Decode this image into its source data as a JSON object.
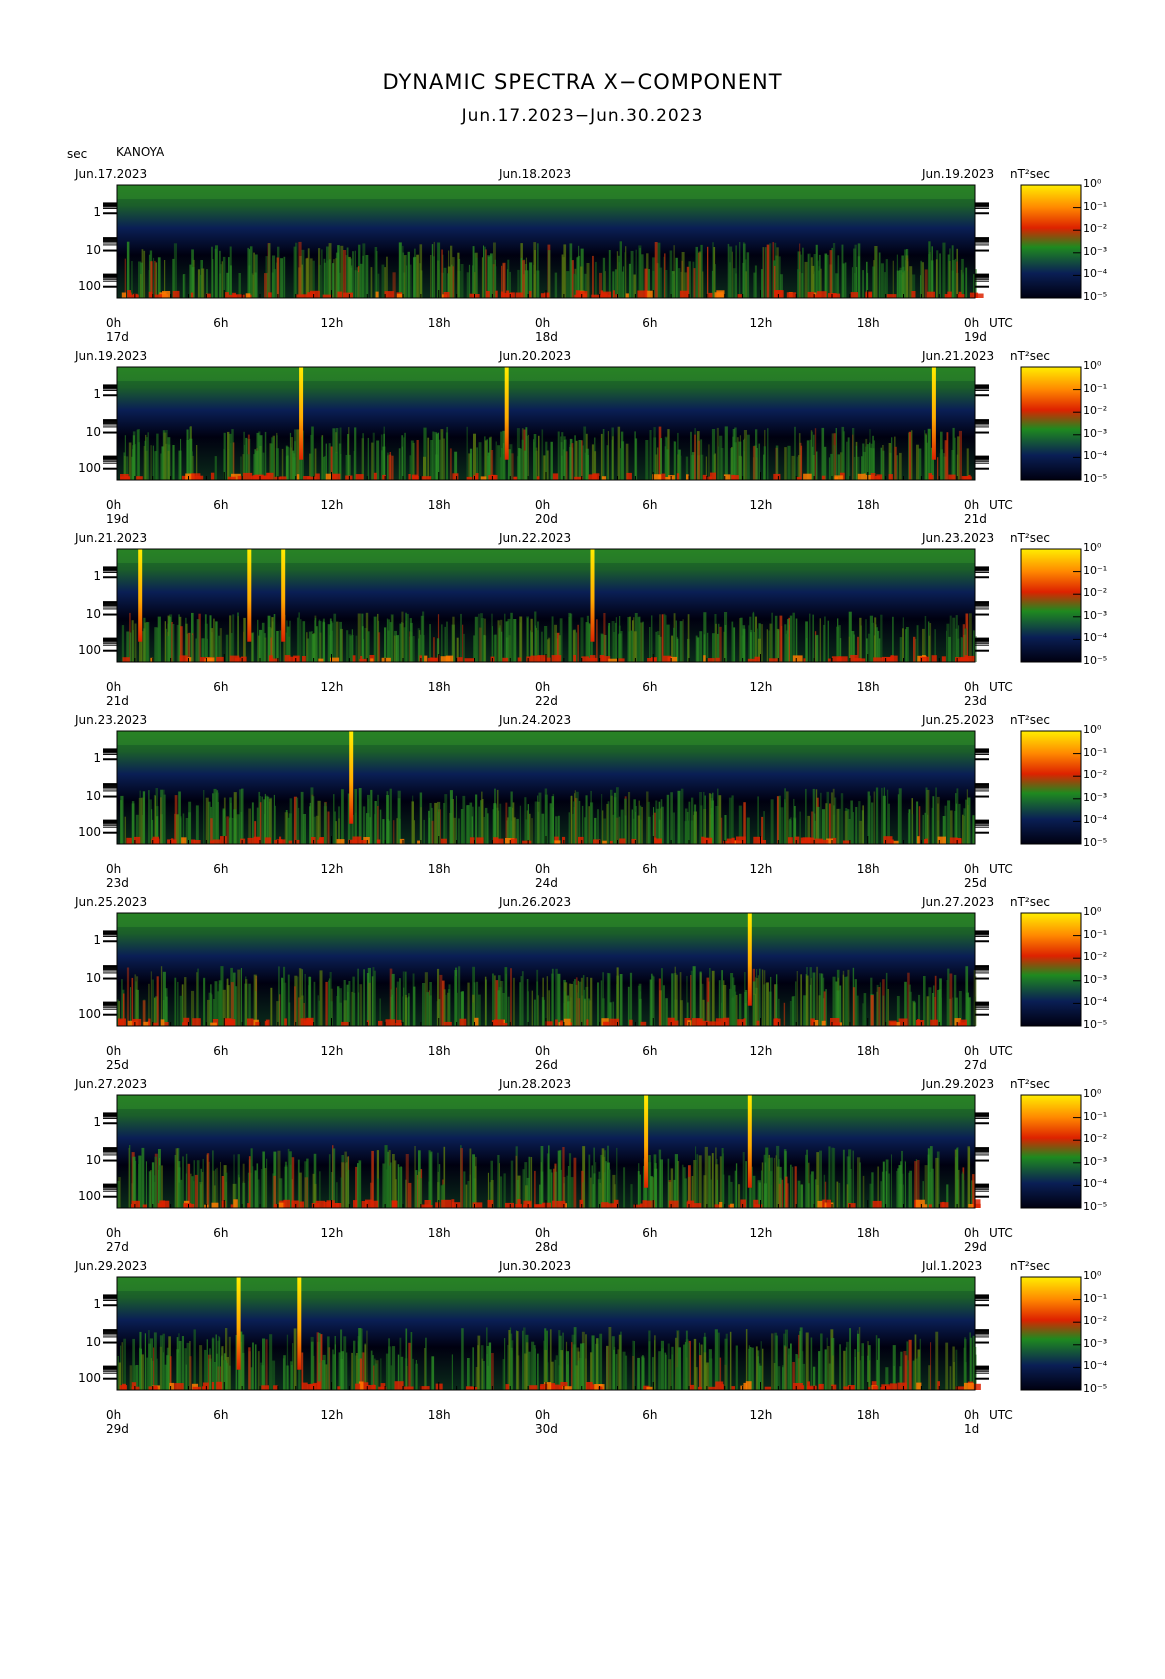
{
  "header": {
    "title": "DYNAMIC SPECTRA X−COMPONENT",
    "subtitle": "Jun.17.2023−Jun.30.2023",
    "y_unit": "sec",
    "station": "KANOYA"
  },
  "colors": {
    "low": "#000010",
    "mid_low": "#0a1f55",
    "mid": "#1f7a1f",
    "mid_high": "#dd2200",
    "high": "#ffee00"
  },
  "chart_data": {
    "type": "heatmap",
    "x_unit": "UTC",
    "power_unit": "nT²sec",
    "y_ticks": [
      "1",
      "10",
      "100"
    ],
    "hour_ticks": [
      "0h",
      "6h",
      "12h",
      "18h",
      "0h",
      "6h",
      "12h",
      "18h",
      "0h"
    ],
    "colorbar_ticks": [
      "10⁰",
      "10⁻¹",
      "10⁻²",
      "10⁻³",
      "10⁻⁴",
      "10⁻⁵"
    ],
    "panels": [
      {
        "date_start": "Jun.17.2023",
        "date_mid": "Jun.18.2023",
        "date_end": "Jun.19.2023",
        "day_start": "17d",
        "day_mid": "18d",
        "day_end": "19d",
        "spikes_hours": [],
        "intensity": 0.55
      },
      {
        "date_start": "Jun.19.2023",
        "date_mid": "Jun.20.2023",
        "date_end": "Jun.21.2023",
        "day_start": "19d",
        "day_mid": "20d",
        "day_end": "21d",
        "spikes_hours": [
          10.3,
          21.8,
          45.7
        ],
        "intensity": 0.5
      },
      {
        "date_start": "Jun.21.2023",
        "date_mid": "Jun.22.2023",
        "date_end": "Jun.23.2023",
        "day_start": "21d",
        "day_mid": "22d",
        "day_end": "23d",
        "spikes_hours": [
          1.3,
          7.4,
          9.3,
          26.6
        ],
        "intensity": 0.45
      },
      {
        "date_start": "Jun.23.2023",
        "date_mid": "Jun.24.2023",
        "date_end": "Jun.25.2023",
        "day_start": "23d",
        "day_mid": "24d",
        "day_end": "25d",
        "spikes_hours": [
          13.1
        ],
        "intensity": 0.55
      },
      {
        "date_start": "Jun.25.2023",
        "date_mid": "Jun.26.2023",
        "date_end": "Jun.27.2023",
        "day_start": "25d",
        "day_mid": "26d",
        "day_end": "27d",
        "spikes_hours": [
          35.4
        ],
        "intensity": 0.6
      },
      {
        "date_start": "Jun.27.2023",
        "date_mid": "Jun.28.2023",
        "date_end": "Jun.29.2023",
        "day_start": "27d",
        "day_mid": "28d",
        "day_end": "29d",
        "spikes_hours": [
          29.6,
          35.4
        ],
        "intensity": 0.65
      },
      {
        "date_start": "Jun.29.2023",
        "date_mid": "Jun.30.2023",
        "date_end": "Jul.1.2023",
        "day_start": "29d",
        "day_mid": "30d",
        "day_end": "1d",
        "spikes_hours": [
          6.8,
          10.2
        ],
        "intensity": 0.65
      }
    ]
  }
}
